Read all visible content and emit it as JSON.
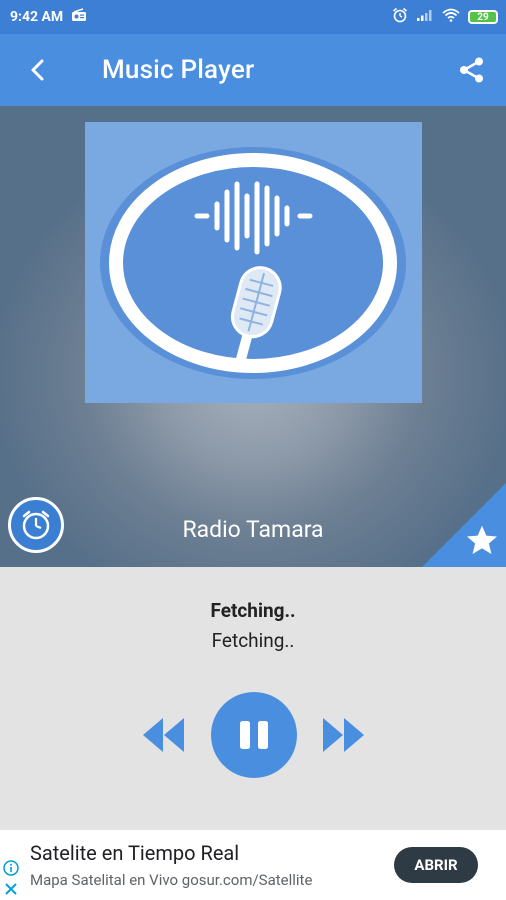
{
  "status_bar": {
    "time": "9:42 AM",
    "battery": "29",
    "icons": [
      "radio-icon",
      "alarm-icon",
      "signal-icon",
      "wifi-icon",
      "battery-icon"
    ]
  },
  "app_bar": {
    "title": "Music Player",
    "back_icon": "arrow-back-icon",
    "share_icon": "share-icon"
  },
  "hero": {
    "station_name": "Radio Tamara",
    "artwork_icon": "microphone-soundwave-icon",
    "timer_icon": "clock-icon",
    "favorite_icon": "star-icon"
  },
  "player": {
    "track_title": "Fetching..",
    "track_subtitle": "Fetching..",
    "prev_icon": "rewind-icon",
    "play_icon": "pause-icon",
    "next_icon": "fast-forward-icon"
  },
  "ad": {
    "title": "Satelite en Tiempo Real",
    "subtitle": "Mapa Satelital en Vivo gosur.com/Satellite",
    "cta": "ABRIR"
  },
  "colors": {
    "primary": "#4a8ee0",
    "status_bar": "#3d7fd4",
    "artwork_bg": "#7aa9e2",
    "player_bg": "#e3e3e3",
    "ad_cta_bg": "#2e3b44"
  }
}
